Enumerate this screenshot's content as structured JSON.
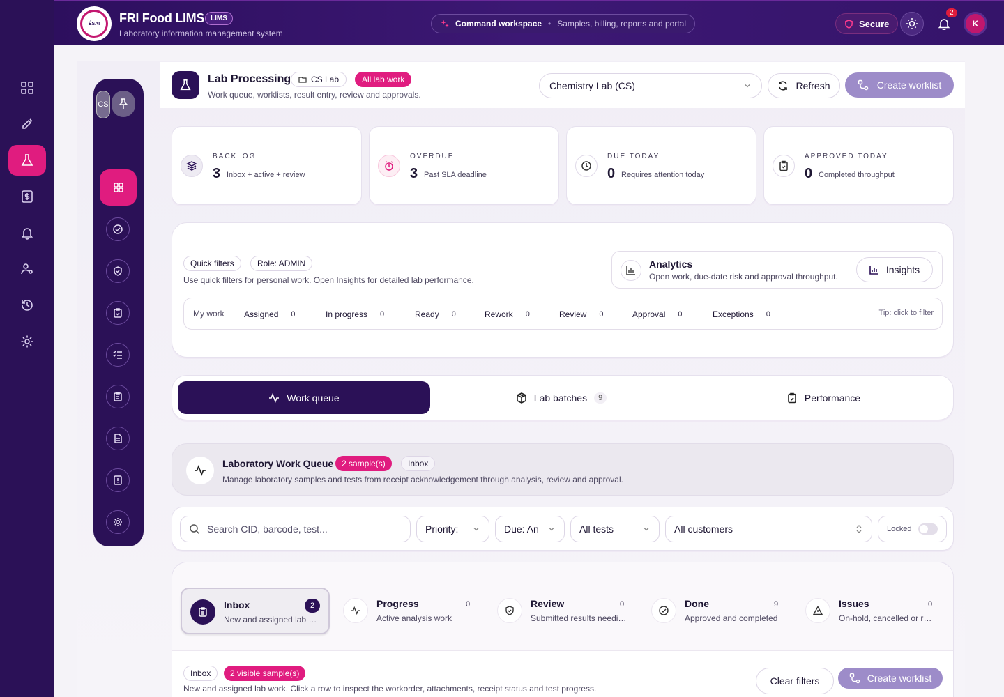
{
  "app": {
    "title": "FRI Food LIMS",
    "badge": "LIMS",
    "subtitle": "Laboratory information management system",
    "logo_text": "ÉSAI"
  },
  "command": {
    "title": "Command workspace",
    "subtitle": "Samples, billing, reports and portal"
  },
  "topbar": {
    "secure_label": "Secure",
    "notification_count": "2",
    "avatar_initial": "K"
  },
  "sidebar_icons": [
    "dashboard-icon",
    "syringe-icon",
    "flask-icon",
    "billing-icon",
    "bell-icon",
    "users-settings-icon",
    "history-icon",
    "settings-icon"
  ],
  "subnav": {
    "cs_label": "CS",
    "icons": [
      "dashboard-icon",
      "check-circle-icon",
      "shield-icon",
      "clipboard-check-icon",
      "list-check-icon",
      "clipboard-icon",
      "document-icon",
      "alert-icon",
      "gear-icon"
    ]
  },
  "header": {
    "title": "Lab Processing",
    "cs_lab": "CS Lab",
    "all_lab_work": "All lab work",
    "subtitle": "Work queue, worklists, result entry, review and approvals.",
    "lab_select": "Chemistry Lab (CS)",
    "refresh": "Refresh",
    "create_worklist": "Create worklist"
  },
  "stats": [
    {
      "label": "BACKLOG",
      "value": "3",
      "desc": "Inbox + active + review"
    },
    {
      "label": "OVERDUE",
      "value": "3",
      "desc": "Past SLA deadline"
    },
    {
      "label": "DUE TODAY",
      "value": "0",
      "desc": "Requires attention today"
    },
    {
      "label": "APPROVED TODAY",
      "value": "0",
      "desc": "Completed throughput"
    }
  ],
  "filters": {
    "quick_filters": "Quick filters",
    "role": "Role: ADMIN",
    "help": "Use quick filters for personal work. Open Insights for detailed lab performance.",
    "analytics_title": "Analytics",
    "analytics_desc": "Open work, due-date risk and approval throughput.",
    "insights": "Insights",
    "my_work": "My work",
    "tip": "Tip: click to filter",
    "items": [
      {
        "label": "Assigned",
        "count": "0"
      },
      {
        "label": "In progress",
        "count": "0"
      },
      {
        "label": "Ready",
        "count": "0"
      },
      {
        "label": "Rework",
        "count": "0"
      },
      {
        "label": "Review",
        "count": "0"
      },
      {
        "label": "Approval",
        "count": "0"
      },
      {
        "label": "Exceptions",
        "count": "0"
      }
    ]
  },
  "tabs": [
    {
      "label": "Work queue"
    },
    {
      "label": "Lab batches",
      "count": "9"
    },
    {
      "label": "Performance"
    }
  ],
  "work_queue": {
    "title": "Laboratory Work Queue",
    "samples": "2 sample(s)",
    "inbox": "Inbox",
    "desc": "Manage laboratory samples and tests from receipt acknowledgement through analysis, review and approval."
  },
  "search": {
    "placeholder": "Search CID, barcode, test...",
    "priority": "Priority: ",
    "due": "Due: An",
    "tests": "All tests",
    "customers": "All customers",
    "locked": "Locked"
  },
  "stages": [
    {
      "title": "Inbox",
      "desc": "New and assigned lab work",
      "count": "2"
    },
    {
      "title": "Progress",
      "desc": "Active analysis work",
      "count": "0"
    },
    {
      "title": "Review",
      "desc": "Submitted results needing review",
      "count": "0"
    },
    {
      "title": "Done",
      "desc": "Approved and completed",
      "count": "9"
    },
    {
      "title": "Issues",
      "desc": "On-hold, cancelled or rejected",
      "count": "0"
    }
  ],
  "inbox_panel": {
    "chip": "Inbox",
    "visible": "2 visible sample(s)",
    "desc": "New and assigned lab work. Click a row to inspect the workorder, attachments, receipt status and test progress.",
    "clear_filters": "Clear filters",
    "create_worklist": "Create worklist"
  },
  "colors": {
    "brand": "#2b1157",
    "accent": "#e01c7f",
    "muted_button": "#9d8cc9"
  }
}
